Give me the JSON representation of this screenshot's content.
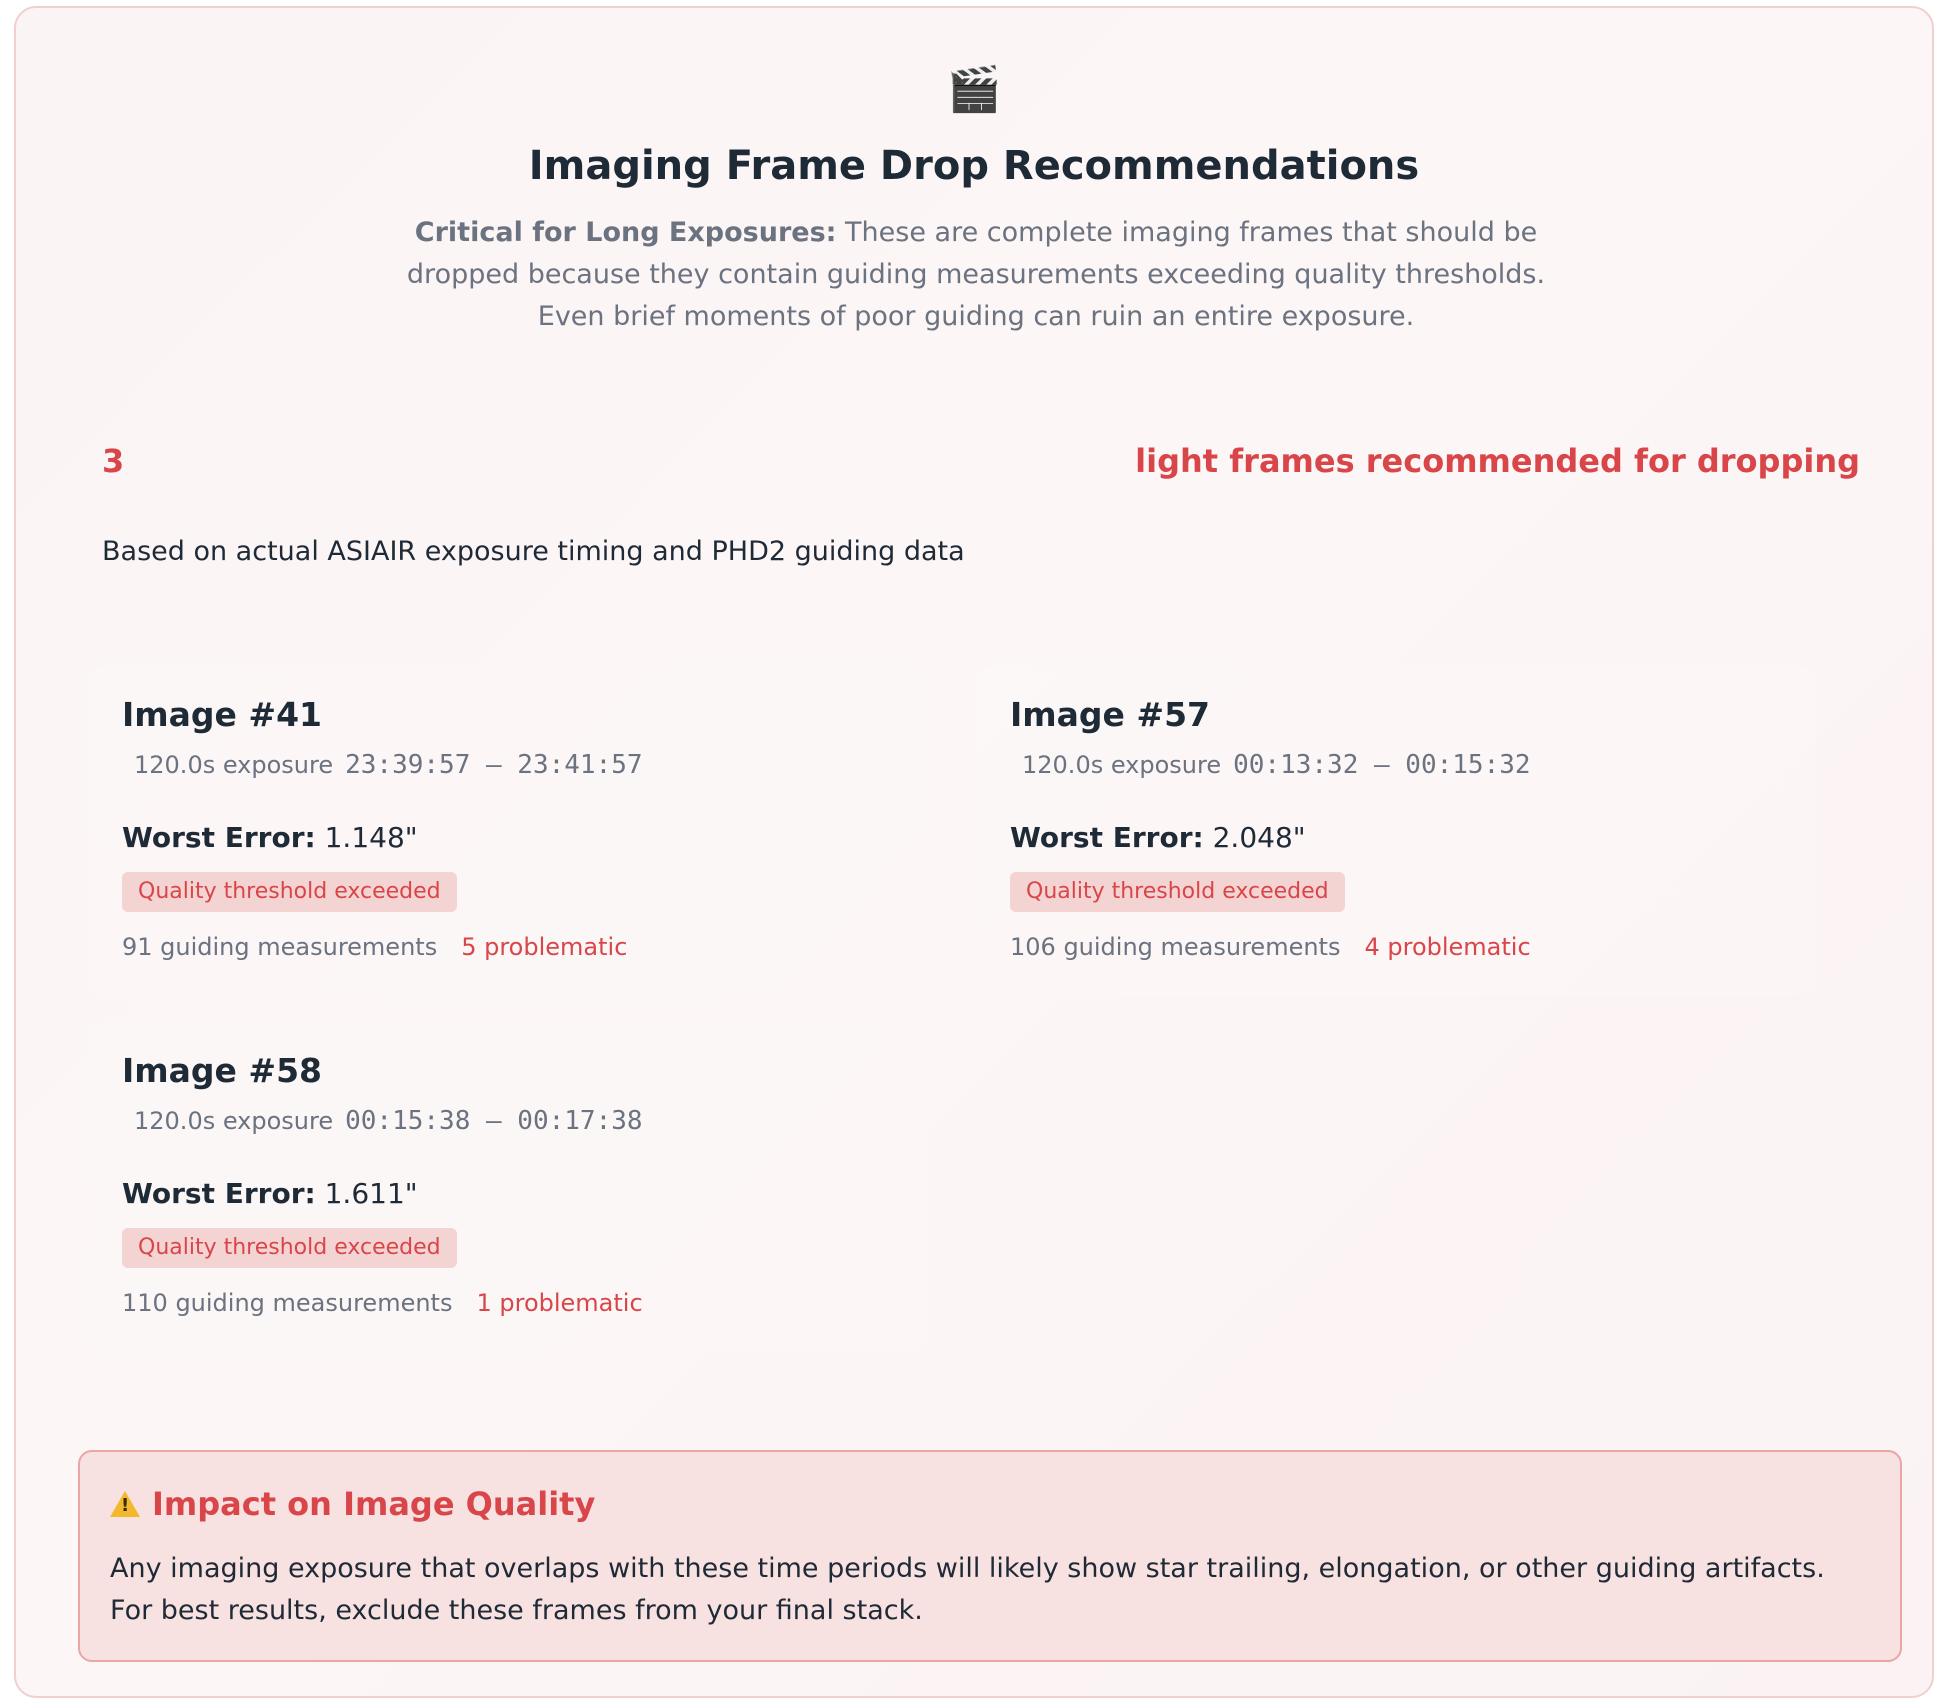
{
  "header": {
    "icon": "clapperboard-icon",
    "icon_glyph": "🎬",
    "title": "Imaging Frame Drop Recommendations",
    "desc_bold": "Critical for Long Exposures:",
    "desc_text": " These are complete imaging frames that should be dropped because they contain guiding measurements exceeding quality thresholds. Even brief moments of poor guiding can ruin an entire exposure."
  },
  "summary": {
    "count": "3",
    "count_label": "light frames recommended for dropping",
    "basis": "Based on actual ASIAIR exposure timing and PHD2 guiding data"
  },
  "frames": [
    {
      "title": "Image #41",
      "exposure": "120.0s exposure",
      "time": "23:39:57 – 23:41:57",
      "worst_label": "Worst Error:",
      "worst_value": " 1.148\"",
      "badge": "Quality threshold exceeded",
      "measurements": "91 guiding measurements",
      "problematic": "5 problematic"
    },
    {
      "title": "Image #57",
      "exposure": "120.0s exposure",
      "time": "00:13:32 – 00:15:32",
      "worst_label": "Worst Error:",
      "worst_value": " 2.048\"",
      "badge": "Quality threshold exceeded",
      "measurements": "106 guiding measurements",
      "problematic": "4 problematic"
    },
    {
      "title": "Image #58",
      "exposure": "120.0s exposure",
      "time": "00:15:38 – 00:17:38",
      "worst_label": "Worst Error:",
      "worst_value": " 1.611\"",
      "badge": "Quality threshold exceeded",
      "measurements": "110 guiding measurements",
      "problematic": "1 problematic"
    }
  ],
  "impact": {
    "icon": "warning-icon",
    "title": "Impact on Image Quality",
    "body": "Any imaging exposure that overlaps with these time periods will likely show star trailing, elongation, or other guiding artifacts. For best results, exclude these frames from your final stack."
  },
  "colors": {
    "accent_red": "#d9464a",
    "heading_dark": "#1f2a37",
    "muted_gray": "#6b7280",
    "badge_bg": "#f4d3d3",
    "impact_bg": "#f7e1e1",
    "panel_border": "#f1cfcf"
  }
}
